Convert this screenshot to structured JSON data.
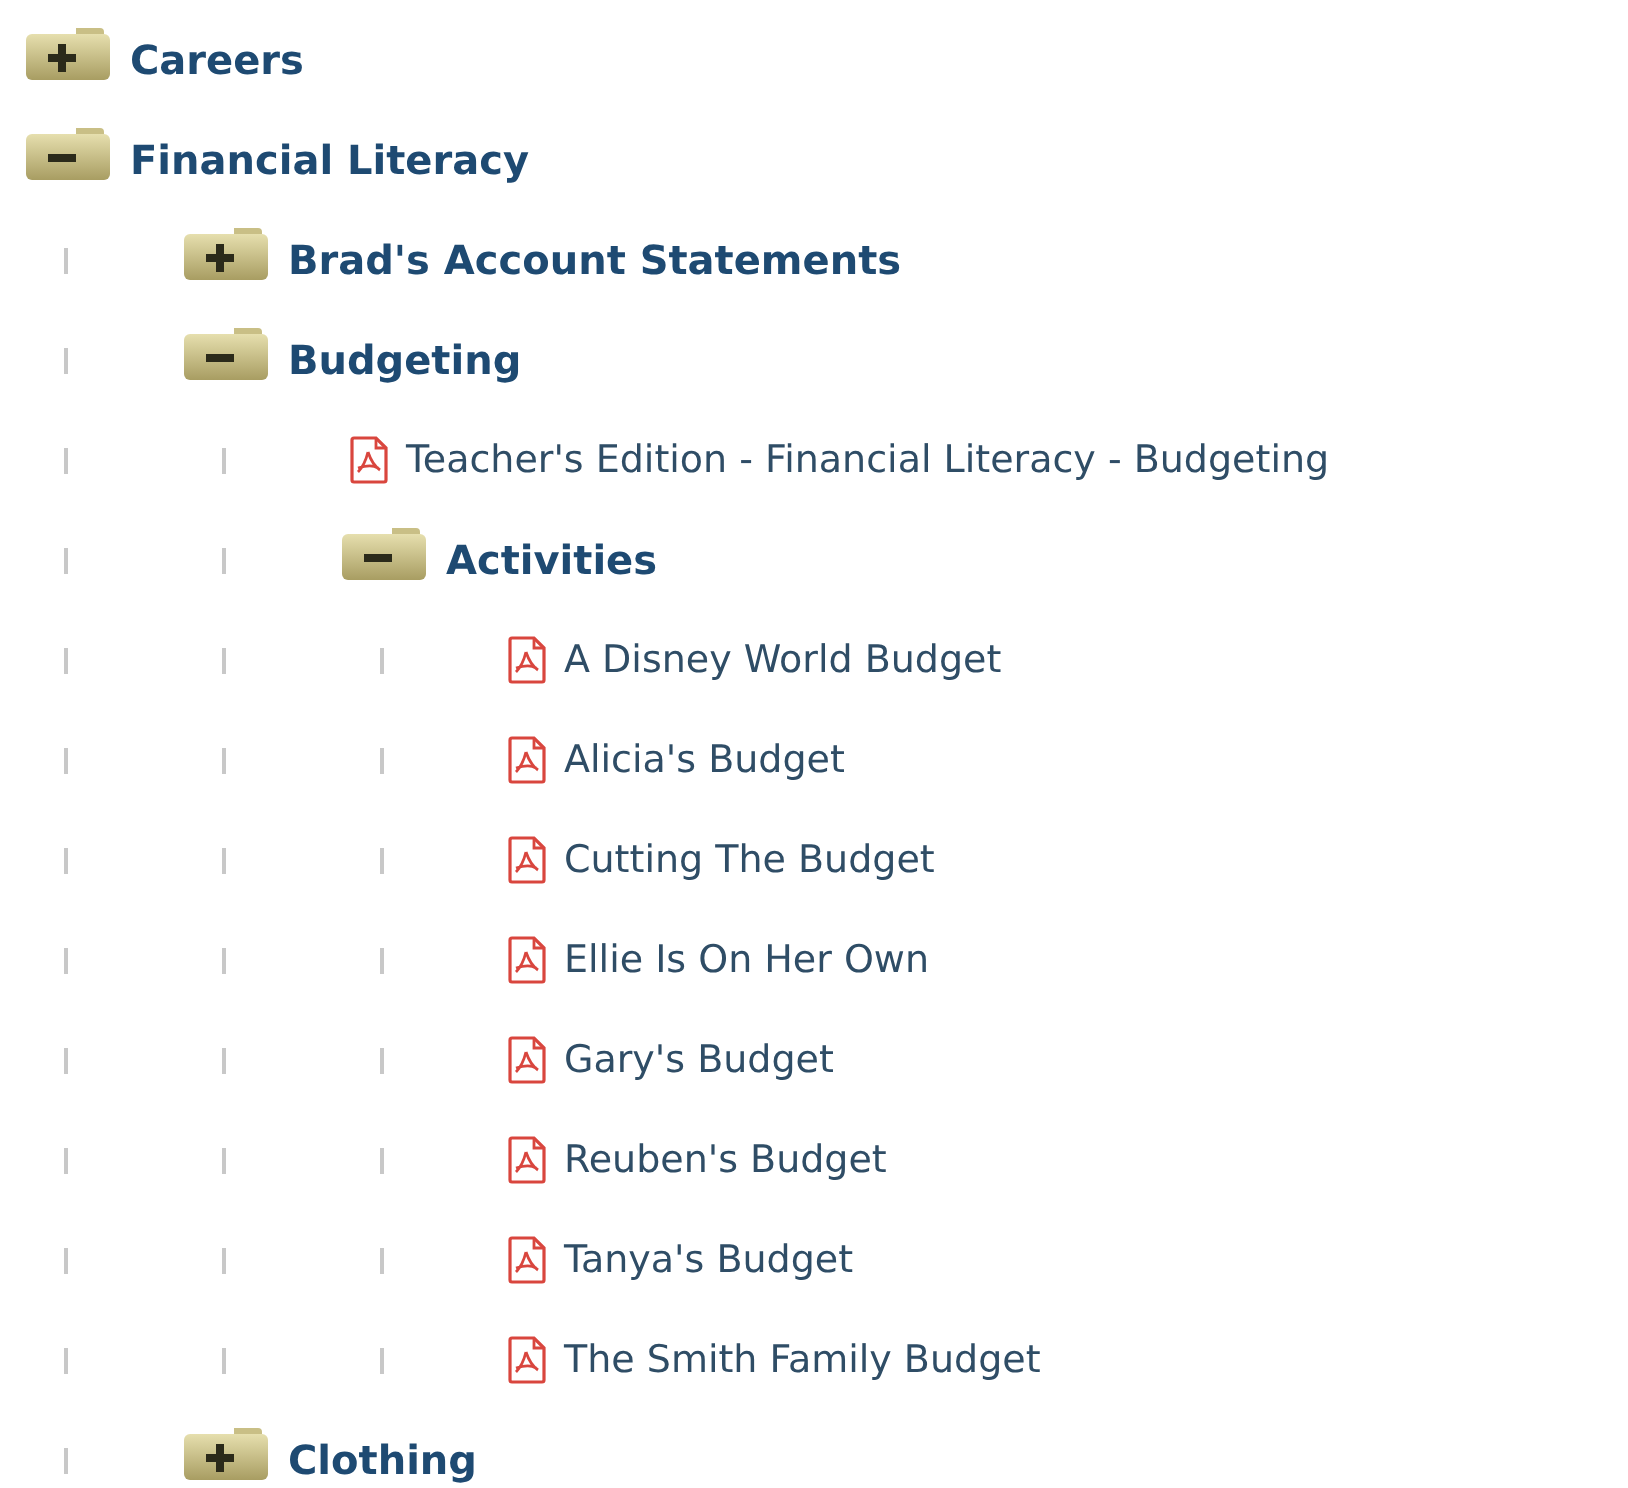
{
  "tree": [
    {
      "kind": "folder",
      "label": "Careers",
      "expanded": false
    },
    {
      "kind": "folder",
      "label": "Financial Literacy",
      "expanded": true,
      "children": [
        {
          "kind": "folder",
          "label": "Brad's Account Statements",
          "expanded": false
        },
        {
          "kind": "folder",
          "label": "Budgeting",
          "expanded": true,
          "children": [
            {
              "kind": "file",
              "label": "Teacher's Edition - Financial Literacy - Budgeting"
            },
            {
              "kind": "folder",
              "label": "Activities",
              "expanded": true,
              "children": [
                {
                  "kind": "file",
                  "label": "A Disney World Budget"
                },
                {
                  "kind": "file",
                  "label": "Alicia's Budget"
                },
                {
                  "kind": "file",
                  "label": "Cutting The Budget"
                },
                {
                  "kind": "file",
                  "label": "Ellie Is On Her Own"
                },
                {
                  "kind": "file",
                  "label": "Gary's Budget"
                },
                {
                  "kind": "file",
                  "label": "Reuben's Budget"
                },
                {
                  "kind": "file",
                  "label": "Tanya's Budget"
                },
                {
                  "kind": "file",
                  "label": "The Smith Family Budget"
                }
              ]
            }
          ]
        },
        {
          "kind": "folder",
          "label": "Clothing",
          "expanded": false
        }
      ]
    }
  ]
}
